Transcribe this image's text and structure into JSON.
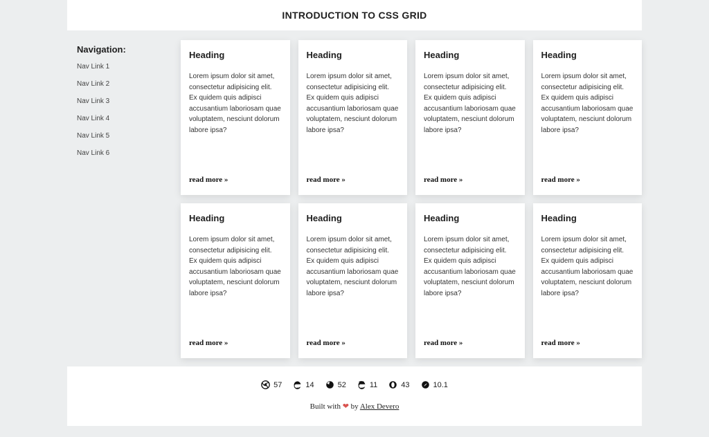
{
  "header": {
    "title": "INTRODUCTION TO CSS GRID"
  },
  "sidebar": {
    "heading": "Navigation:",
    "links": [
      "Nav Link 1",
      "Nav Link 2",
      "Nav Link 3",
      "Nav Link 4",
      "Nav Link 5",
      "Nav Link 6"
    ]
  },
  "cards": [
    {
      "heading": "Heading",
      "body": "Lorem ipsum dolor sit amet, consectetur adipisicing elit. Ex quidem quis adipisci accusantium laboriosam quae voluptatem, nesciunt dolorum labore ipsa?",
      "cta": "read more »"
    },
    {
      "heading": "Heading",
      "body": "Lorem ipsum dolor sit amet, consectetur adipisicing elit. Ex quidem quis adipisci accusantium laboriosam quae voluptatem, nesciunt dolorum labore ipsa?",
      "cta": "read more »"
    },
    {
      "heading": "Heading",
      "body": "Lorem ipsum dolor sit amet, consectetur adipisicing elit. Ex quidem quis adipisci accusantium laboriosam quae voluptatem, nesciunt dolorum labore ipsa?",
      "cta": "read more »"
    },
    {
      "heading": "Heading",
      "body": "Lorem ipsum dolor sit amet, consectetur adipisicing elit. Ex quidem quis adipisci accusantium laboriosam quae voluptatem, nesciunt dolorum labore ipsa?",
      "cta": "read more »"
    },
    {
      "heading": "Heading",
      "body": "Lorem ipsum dolor sit amet, consectetur adipisicing elit. Ex quidem quis adipisci accusantium laboriosam quae voluptatem, nesciunt dolorum labore ipsa?",
      "cta": "read more »"
    },
    {
      "heading": "Heading",
      "body": "Lorem ipsum dolor sit amet, consectetur adipisicing elit. Ex quidem quis adipisci accusantium laboriosam quae voluptatem, nesciunt dolorum labore ipsa?",
      "cta": "read more »"
    },
    {
      "heading": "Heading",
      "body": "Lorem ipsum dolor sit amet, consectetur adipisicing elit. Ex quidem quis adipisci accusantium laboriosam quae voluptatem, nesciunt dolorum labore ipsa?",
      "cta": "read more »"
    },
    {
      "heading": "Heading",
      "body": "Lorem ipsum dolor sit amet, consectetur adipisicing elit. Ex quidem quis adipisci accusantium laboriosam quae voluptatem, nesciunt dolorum labore ipsa?",
      "cta": "read more »"
    }
  ],
  "footer": {
    "browsers": [
      {
        "name": "chrome",
        "version": "57"
      },
      {
        "name": "edge",
        "version": "14"
      },
      {
        "name": "firefox",
        "version": "52"
      },
      {
        "name": "ie",
        "version": "11"
      },
      {
        "name": "opera",
        "version": "43"
      },
      {
        "name": "safari",
        "version": "10.1"
      }
    ],
    "credits_prefix": "Built with ",
    "credits_by": " by ",
    "credits_author": "Alex Devero",
    "heart": "❤"
  }
}
